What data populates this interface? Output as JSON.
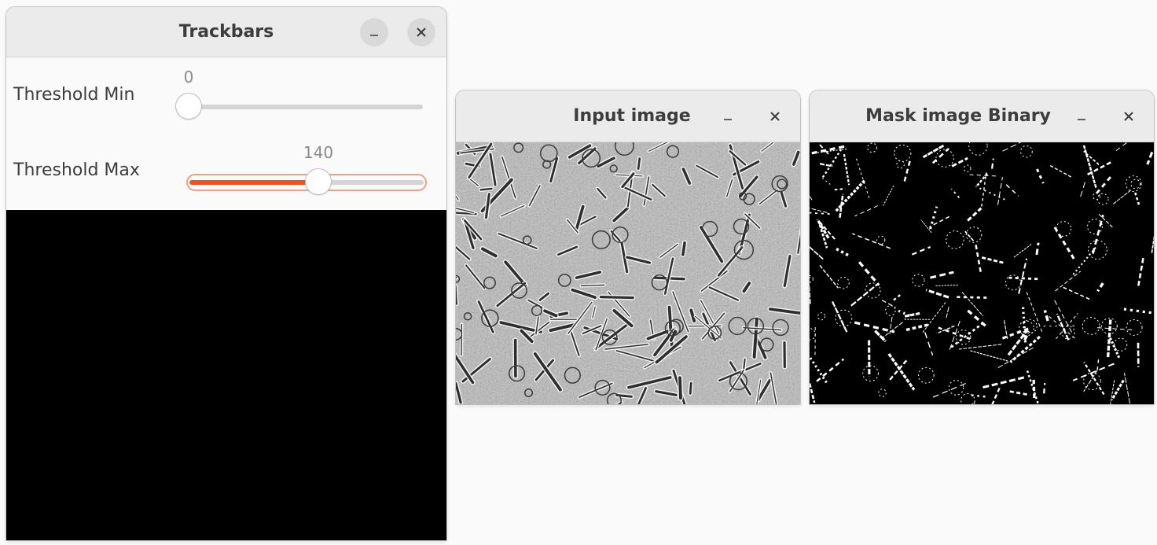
{
  "windows": {
    "trackbars": {
      "title": "Trackbars",
      "minimize_icon": "minimize-icon",
      "close_icon": "close-icon",
      "trackbars": [
        {
          "label": "Threshold Min",
          "value": "0",
          "min": 0,
          "max": 255,
          "fraction": 0.0
        },
        {
          "label": "Threshold Max",
          "value": "140",
          "min": 0,
          "max": 255,
          "fraction": 0.549
        }
      ]
    },
    "input_image": {
      "title": "Input image",
      "minimize_icon": "minimize-icon",
      "close_icon": "close-icon",
      "content": "phase-contrast grayscale cell image"
    },
    "mask_image": {
      "title": "Mask image Binary",
      "minimize_icon": "minimize-icon",
      "close_icon": "close-icon",
      "content": "binary threshold mask"
    }
  },
  "colors": {
    "accent": "#e95420",
    "accent_focus": "#f0a183",
    "titlebar": "#ebebeb",
    "desktop": "#fafafa"
  }
}
